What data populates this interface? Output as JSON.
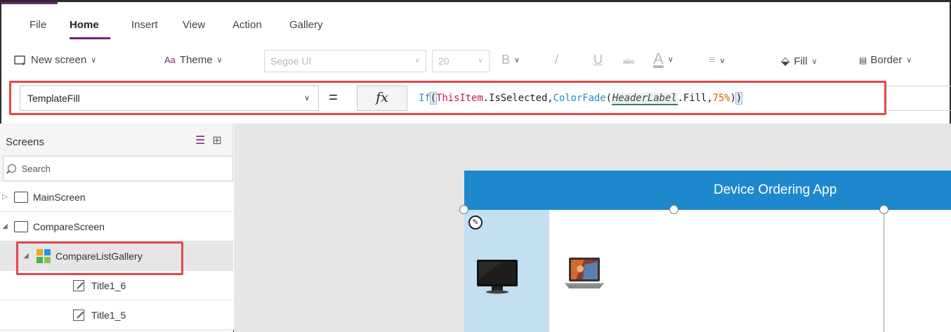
{
  "menu": {
    "tabs": [
      {
        "label": "File"
      },
      {
        "label": "Home"
      },
      {
        "label": "Insert"
      },
      {
        "label": "View"
      },
      {
        "label": "Action"
      },
      {
        "label": "Gallery"
      }
    ],
    "active_tab": "Home"
  },
  "toolbar": {
    "new_screen": "New screen",
    "theme": "Theme",
    "font_family": "Segoe UI",
    "font_size": "20",
    "bold": "B",
    "italic": "/",
    "underline": "U",
    "strike": "abc",
    "font_color": "A",
    "fill": "Fill",
    "border": "Border"
  },
  "formula_bar": {
    "property": "TemplateFill",
    "equals": "=",
    "fx": "fx",
    "tokens": {
      "fn_if": "If",
      "paren_open": "(",
      "object": "ThisItem",
      "member1": ".IsSelected,",
      "fn_colorfade": "ColorFade",
      "paren_open2": "(",
      "control": "HeaderLabel",
      "member2": ".Fill,",
      "percent": "75%",
      "paren_close2": ")",
      "paren_close": ")"
    }
  },
  "tree": {
    "header": "Screens",
    "search_placeholder": "Search",
    "nodes": [
      {
        "label": "MainScreen",
        "arrow": "▷"
      },
      {
        "label": "CompareScreen",
        "arrow": "◢"
      },
      {
        "label": "CompareListGallery",
        "arrow": "◢"
      },
      {
        "label": "Title1_6"
      },
      {
        "label": "Title1_5"
      }
    ]
  },
  "canvas": {
    "app_title": "Device Ordering App",
    "edit_glyph": "✎"
  },
  "colors": {
    "accent_purple": "#742774",
    "header_blue": "#1e88cf",
    "selection_fill": "#c3dff1",
    "highlight_red": "#e5464d"
  }
}
